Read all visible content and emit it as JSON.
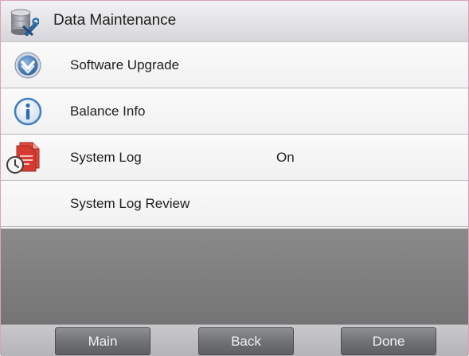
{
  "header": {
    "title": "Data Maintenance",
    "icon": "database-settings-icon"
  },
  "menu": {
    "items": [
      {
        "label": "Software Upgrade",
        "icon": "download-arrow-icon"
      },
      {
        "label": "Balance Info",
        "icon": "info-icon"
      },
      {
        "label": "System Log",
        "value": "On",
        "icon": "log-clock-icon"
      },
      {
        "label": "System Log Review"
      }
    ]
  },
  "footer": {
    "main_label": "Main",
    "back_label": "Back",
    "done_label": "Done"
  },
  "colors": {
    "accent_blue": "#3f7fbf",
    "log_red": "#d63b2f",
    "footer_button": "#6e7074"
  }
}
